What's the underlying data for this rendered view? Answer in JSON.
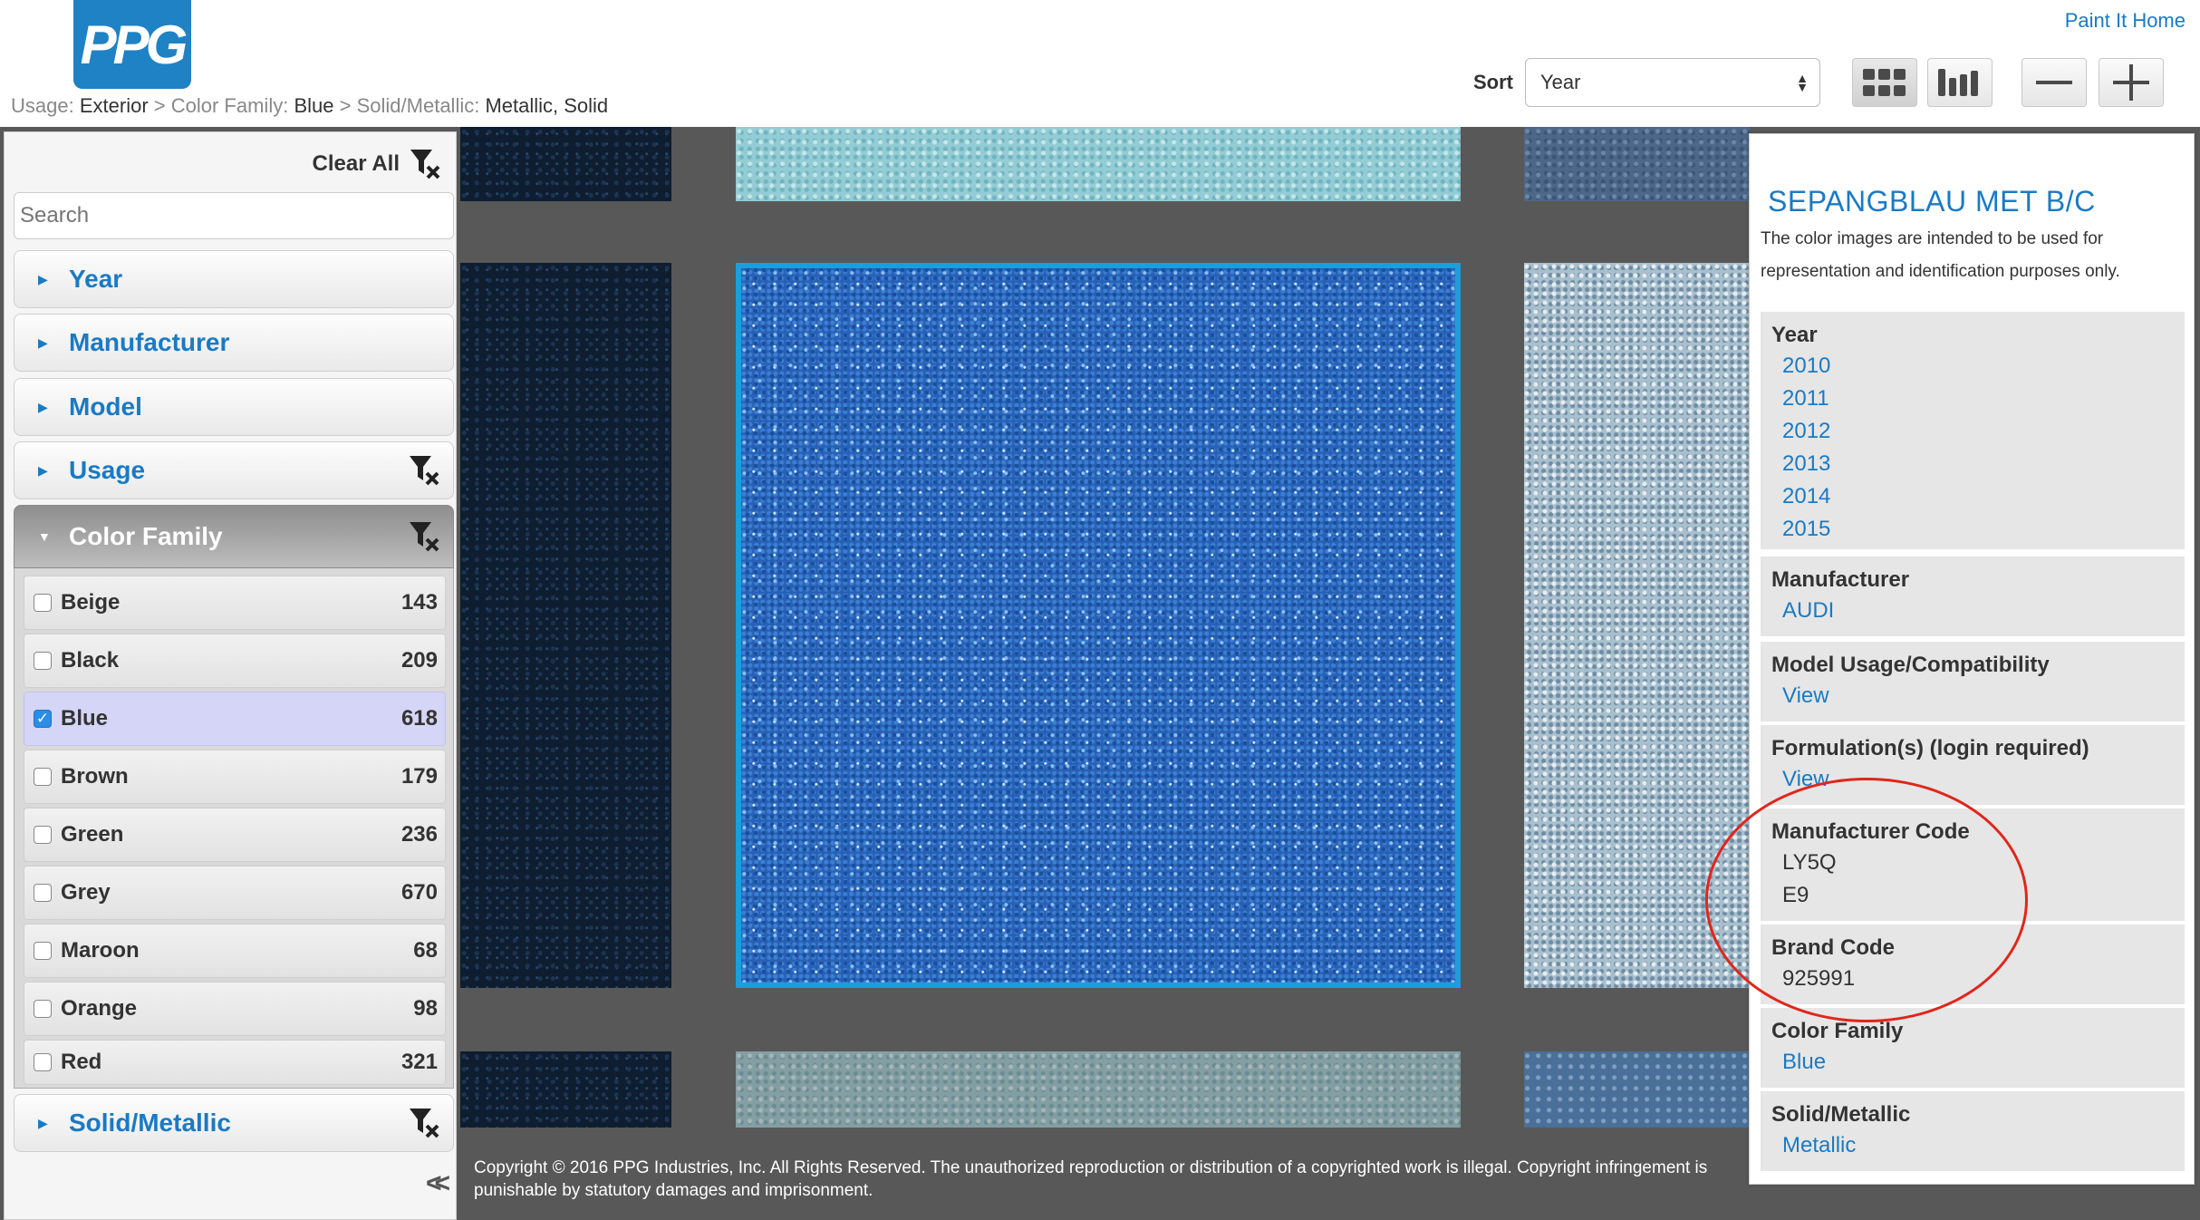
{
  "header": {
    "logo_text": "PPG",
    "home_link": "Paint It Home",
    "sort_label": "Sort",
    "sort_value": "Year",
    "breadcrumb": [
      {
        "key": "Usage:",
        "value": "Exterior"
      },
      {
        "key": "Color Family:",
        "value": "Blue"
      },
      {
        "key": "Solid/Metallic:",
        "value": "Metallic, Solid"
      }
    ],
    "separator": ">"
  },
  "sidebar": {
    "clear_all": "Clear All",
    "search_placeholder": "Search",
    "facets": [
      "Year",
      "Manufacturer",
      "Model",
      "Usage",
      "Color Family",
      "Solid/Metallic"
    ],
    "color_family": [
      {
        "name": "Beige",
        "count": "143",
        "checked": false
      },
      {
        "name": "Black",
        "count": "209",
        "checked": false
      },
      {
        "name": "Blue",
        "count": "618",
        "checked": true
      },
      {
        "name": "Brown",
        "count": "179",
        "checked": false
      },
      {
        "name": "Green",
        "count": "236",
        "checked": false
      },
      {
        "name": "Grey",
        "count": "670",
        "checked": false
      },
      {
        "name": "Maroon",
        "count": "68",
        "checked": false
      },
      {
        "name": "Orange",
        "count": "98",
        "checked": false
      },
      {
        "name": "Red",
        "count": "321",
        "checked": false
      }
    ],
    "collapse_glyph": "<<"
  },
  "detail": {
    "title": "SEPANGBLAU MET B/C",
    "disclaimer": "The color images are intended to be used for representation and identification purposes only.",
    "year_heading": "Year",
    "years": [
      "2010",
      "2011",
      "2012",
      "2013",
      "2014",
      "2015"
    ],
    "manufacturer_heading": "Manufacturer",
    "manufacturer": "AUDI",
    "model_heading": "Model Usage/Compatibility",
    "model_link": "View",
    "formulation_heading": "Formulation(s) (login required)",
    "formulation_link": "View",
    "mfr_code_heading": "Manufacturer Code",
    "mfr_codes": [
      "LY5Q",
      "E9"
    ],
    "brand_code_heading": "Brand Code",
    "brand_code": "925991",
    "color_family_heading": "Color Family",
    "color_family": "Blue",
    "solid_metallic_heading": "Solid/Metallic",
    "solid_metallic": "Metallic"
  },
  "footer": {
    "copyright": "Copyright © 2016 PPG Industries, Inc. All Rights Reserved. The unauthorized reproduction or distribution of a copyrighted work is illegal. Copyright infringement is punishable by statutory damages and imprisonment."
  },
  "colors": {
    "accent": "#1a7ac4",
    "selection_border": "#1a9ee0",
    "annotation": "#e0261b",
    "grid_background": "#585858"
  }
}
